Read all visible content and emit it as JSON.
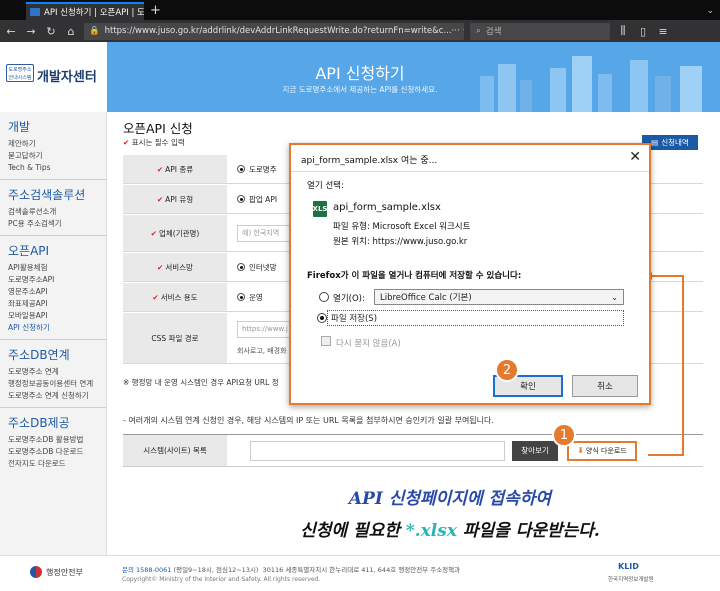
{
  "browser": {
    "tab_title": "API 신청하기 | 오픈API | 도로명",
    "url": "https://www.juso.go.kr/addrlink/devAddrLinkRequestWrite.do?returnFn=write&c...",
    "search_placeholder": "검색"
  },
  "header": {
    "logo_name": "개발자센터",
    "logo_mark": "도로명주소 안내시스템",
    "title": "API 신청하기",
    "subtitle": "지금 도로명주소에서 제공하는 API를 신청하세요."
  },
  "sidebar": {
    "sections": [
      {
        "title": "개발",
        "items": [
          "제안하기",
          "묻고답하기",
          "Tech & Tips"
        ]
      },
      {
        "title": "주소검색솔루션",
        "items": [
          "검색솔루션소개",
          "PC용 주소검색기"
        ]
      },
      {
        "title": "오픈API",
        "items": [
          "API활용체험",
          "도로명주소API",
          "영문주소API",
          "좌표제공API",
          "모바일용API",
          "API 신청하기"
        ]
      },
      {
        "title": "주소DB연계",
        "items": [
          "도로명주소 연계",
          "행정정보공동이용센터 연계",
          "도로명주소 연계 신청하기"
        ]
      },
      {
        "title": "주소DB제공",
        "items": [
          "도로명주소DB 활용방법",
          "도로명주소DB 다운로드",
          "전자지도 다운로드"
        ]
      }
    ]
  },
  "main": {
    "page_title": "오픈API 신청",
    "required_note": "표시는 필수 입력",
    "apply_info_button": "신청내역",
    "rows": [
      {
        "label": "API 종류",
        "value": "도로명주"
      },
      {
        "label": "API 유형",
        "value": "팝업 API"
      },
      {
        "label": "업체(기관명)",
        "value": "예) 한국지역"
      },
      {
        "label": "서비스망",
        "value": "인터넷망"
      },
      {
        "label": "서비스 용도",
        "value": "운영"
      },
      {
        "label": "CSS 파일 경로",
        "value": "https://www.j",
        "value2": "회사로고, 배경화"
      }
    ],
    "note1": "※ 행정망 내 운영 시스템인 경우 API요청 URL 정",
    "note2": "- 여러개의 시스템 연계 신청인 경우, 해당 시스템의 IP 또는 URL 목록을 첨부하시면 승인키가 일괄 부여됩니다.",
    "system_list_label": "시스템(사이트) 목록",
    "browse_button": "찾아보기",
    "download_button": "양식 다운로드"
  },
  "callout": {
    "line1": "API 신청페이지에 접속하여",
    "line2_pre": "신청에 필요한 ",
    "line2_hl": "*.xlsx",
    "line2_post": " 파일을 다운받는다."
  },
  "dialog": {
    "title": "api_form_sample.xlsx 여는 중...",
    "open_choice_label": "열기 선택:",
    "file_icon": "XLS",
    "file_name": "api_form_sample.xlsx",
    "file_type": "파일 유형:  Microsoft Excel 워크시트",
    "source": "원본 위치:  https://www.juso.go.kr",
    "question": "Firefox가 이 파일을 열거나 컴퓨터에 저장할 수 있습니다:",
    "open_with_label": "열기(O):",
    "open_with_app": "LibreOffice Calc (기본)",
    "save_file_label": "파일 저장(S)",
    "dont_ask_label": "다시 묻지 않음(A)",
    "ok_button": "확인",
    "cancel_button": "취소"
  },
  "badges": {
    "step1": "1",
    "step2": "2"
  },
  "footer": {
    "ministry": "행정안전부",
    "contact": "문의 1588-0061",
    "hours": "(평일9~18시, 점심12~13시)",
    "address": "30116 세종특별자치시 한누리대로 411, 644호 행정안전부 주소정책과",
    "copyright": "Copyright© Ministry of the Interior and Safety. All rights reserved.",
    "klid": "KLID",
    "klid_sub": "한국지역정보개발원"
  },
  "colors": {
    "accent": "#1c5aa6",
    "highlight": "#e37a2f",
    "header_bg": "#57a6e8"
  }
}
